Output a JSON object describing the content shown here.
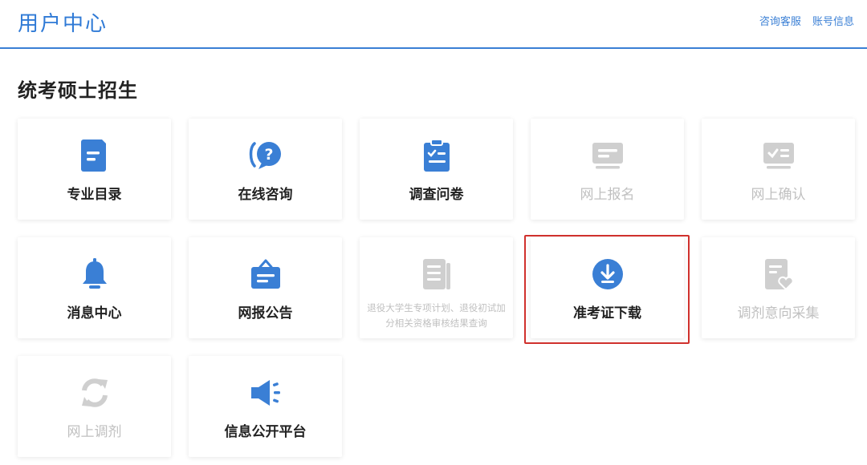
{
  "header": {
    "title": "用户中心",
    "links": [
      "咨询客服",
      "账号信息"
    ]
  },
  "section": {
    "title": "统考硕士招生"
  },
  "colors": {
    "brand": "#2f7ad6",
    "icon_active": "#3a7fd5",
    "icon_disabled": "#cfcfcf",
    "highlight": "#d0312d"
  },
  "cards": [
    {
      "label": "专业目录",
      "icon": "document-icon",
      "enabled": true
    },
    {
      "label": "在线咨询",
      "icon": "question-chat-icon",
      "enabled": true
    },
    {
      "label": "调查问卷",
      "icon": "clipboard-check-icon",
      "enabled": true
    },
    {
      "label": "网上报名",
      "icon": "monitor-icon",
      "enabled": false
    },
    {
      "label": "网上确认",
      "icon": "monitor-check-icon",
      "enabled": false
    },
    {
      "label": "消息中心",
      "icon": "bell-icon",
      "enabled": true
    },
    {
      "label": "网报公告",
      "icon": "notice-board-icon",
      "enabled": true
    },
    {
      "label": "退役大学生专项计划、退役初试加分相关资格审核结果查询",
      "icon": "list-document-icon",
      "enabled": false
    },
    {
      "label": "准考证下载",
      "icon": "download-icon",
      "enabled": true,
      "highlighted": true
    },
    {
      "label": "调剂意向采集",
      "icon": "document-heart-icon",
      "enabled": false
    },
    {
      "label": "网上调剂",
      "icon": "refresh-icon",
      "enabled": false
    },
    {
      "label": "信息公开平台",
      "icon": "speaker-icon",
      "enabled": true
    }
  ]
}
